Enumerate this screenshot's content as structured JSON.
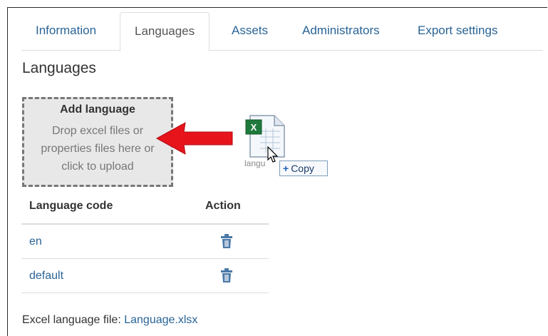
{
  "tabs": [
    {
      "label": "Information"
    },
    {
      "label": "Languages",
      "active": true
    },
    {
      "label": "Assets"
    },
    {
      "label": "Administrators"
    },
    {
      "label": "Export settings"
    }
  ],
  "page": {
    "heading": "Languages"
  },
  "dropzone": {
    "title": "Add language",
    "text": "Drop excel files or properties files here or click to upload"
  },
  "drag": {
    "file_label": "langu",
    "copy_label": "Copy",
    "icon": "excel-file-icon"
  },
  "table": {
    "headers": {
      "code": "Language code",
      "action": "Action"
    },
    "rows": [
      {
        "code": "en",
        "action_icon": "trash-icon"
      },
      {
        "code": "default",
        "action_icon": "trash-icon"
      }
    ]
  },
  "footer": {
    "label": "Excel language file:",
    "link": "Language.xlsx"
  },
  "colors": {
    "link": "#2a6496",
    "arrow": "#e8141c",
    "dropzone_bg": "#e8e8e8"
  }
}
